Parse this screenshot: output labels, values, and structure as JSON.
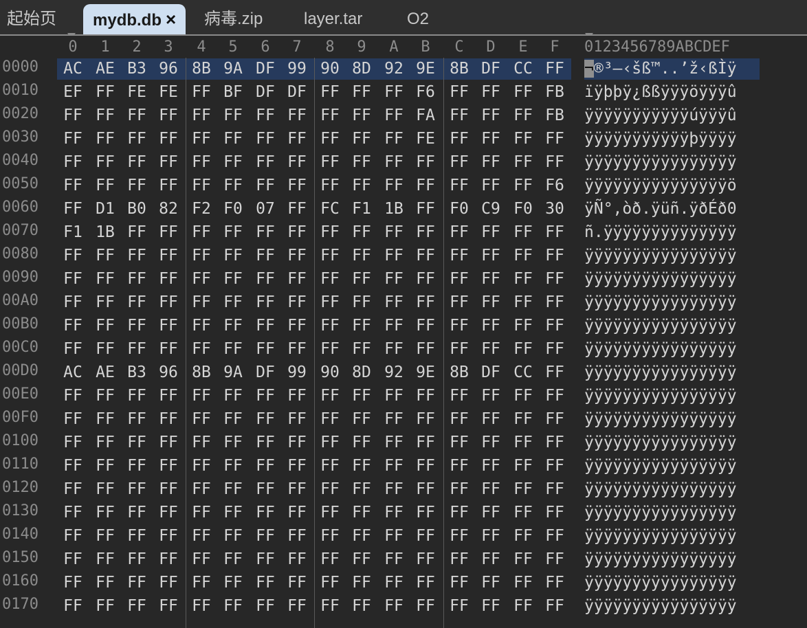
{
  "tabs": [
    {
      "label": "起始页",
      "active": false
    },
    {
      "label": "mydb.db",
      "active": true,
      "close": "×"
    },
    {
      "label": "病毒.zip",
      "active": false
    },
    {
      "label": "layer.tar",
      "active": false
    },
    {
      "label": "O2",
      "active": false
    }
  ],
  "header": {
    "columns": [
      "0",
      "1",
      "2",
      "3",
      "4",
      "5",
      "6",
      "7",
      "8",
      "9",
      "A",
      "B",
      "C",
      "D",
      "E",
      "F"
    ],
    "ascii_header": "0123456789ABCDEF"
  },
  "rows": [
    {
      "addr": "0000",
      "bytes": [
        "AC",
        "AE",
        "B3",
        "96",
        "8B",
        "9A",
        "DF",
        "99",
        "90",
        "8D",
        "92",
        "9E",
        "8B",
        "DF",
        "CC",
        "FF"
      ],
      "ascii": "¬®³–‹šß™..’ž‹ßÌÿ",
      "selected": true
    },
    {
      "addr": "0010",
      "bytes": [
        "EF",
        "FF",
        "FE",
        "FE",
        "FF",
        "BF",
        "DF",
        "DF",
        "FF",
        "FF",
        "FF",
        "F6",
        "FF",
        "FF",
        "FF",
        "FB"
      ],
      "ascii": "ïÿþþÿ¿ßßÿÿÿöÿÿÿû"
    },
    {
      "addr": "0020",
      "bytes": [
        "FF",
        "FF",
        "FF",
        "FF",
        "FF",
        "FF",
        "FF",
        "FF",
        "FF",
        "FF",
        "FF",
        "FA",
        "FF",
        "FF",
        "FF",
        "FB"
      ],
      "ascii": "ÿÿÿÿÿÿÿÿÿÿÿúÿÿÿû"
    },
    {
      "addr": "0030",
      "bytes": [
        "FF",
        "FF",
        "FF",
        "FF",
        "FF",
        "FF",
        "FF",
        "FF",
        "FF",
        "FF",
        "FF",
        "FE",
        "FF",
        "FF",
        "FF",
        "FF"
      ],
      "ascii": "ÿÿÿÿÿÿÿÿÿÿÿþÿÿÿÿ"
    },
    {
      "addr": "0040",
      "bytes": [
        "FF",
        "FF",
        "FF",
        "FF",
        "FF",
        "FF",
        "FF",
        "FF",
        "FF",
        "FF",
        "FF",
        "FF",
        "FF",
        "FF",
        "FF",
        "FF"
      ],
      "ascii": "ÿÿÿÿÿÿÿÿÿÿÿÿÿÿÿÿ"
    },
    {
      "addr": "0050",
      "bytes": [
        "FF",
        "FF",
        "FF",
        "FF",
        "FF",
        "FF",
        "FF",
        "FF",
        "FF",
        "FF",
        "FF",
        "FF",
        "FF",
        "FF",
        "FF",
        "F6"
      ],
      "ascii": "ÿÿÿÿÿÿÿÿÿÿÿÿÿÿÿö"
    },
    {
      "addr": "0060",
      "bytes": [
        "FF",
        "D1",
        "B0",
        "82",
        "F2",
        "F0",
        "07",
        "FF",
        "FC",
        "F1",
        "1B",
        "FF",
        "F0",
        "C9",
        "F0",
        "30"
      ],
      "ascii": "ÿÑ°‚òð.ÿüñ.ÿðÉð0"
    },
    {
      "addr": "0070",
      "bytes": [
        "F1",
        "1B",
        "FF",
        "FF",
        "FF",
        "FF",
        "FF",
        "FF",
        "FF",
        "FF",
        "FF",
        "FF",
        "FF",
        "FF",
        "FF",
        "FF"
      ],
      "ascii": "ñ.ÿÿÿÿÿÿÿÿÿÿÿÿÿÿ"
    },
    {
      "addr": "0080",
      "bytes": [
        "FF",
        "FF",
        "FF",
        "FF",
        "FF",
        "FF",
        "FF",
        "FF",
        "FF",
        "FF",
        "FF",
        "FF",
        "FF",
        "FF",
        "FF",
        "FF"
      ],
      "ascii": "ÿÿÿÿÿÿÿÿÿÿÿÿÿÿÿÿ"
    },
    {
      "addr": "0090",
      "bytes": [
        "FF",
        "FF",
        "FF",
        "FF",
        "FF",
        "FF",
        "FF",
        "FF",
        "FF",
        "FF",
        "FF",
        "FF",
        "FF",
        "FF",
        "FF",
        "FF"
      ],
      "ascii": "ÿÿÿÿÿÿÿÿÿÿÿÿÿÿÿÿ"
    },
    {
      "addr": "00A0",
      "bytes": [
        "FF",
        "FF",
        "FF",
        "FF",
        "FF",
        "FF",
        "FF",
        "FF",
        "FF",
        "FF",
        "FF",
        "FF",
        "FF",
        "FF",
        "FF",
        "FF"
      ],
      "ascii": "ÿÿÿÿÿÿÿÿÿÿÿÿÿÿÿÿ"
    },
    {
      "addr": "00B0",
      "bytes": [
        "FF",
        "FF",
        "FF",
        "FF",
        "FF",
        "FF",
        "FF",
        "FF",
        "FF",
        "FF",
        "FF",
        "FF",
        "FF",
        "FF",
        "FF",
        "FF"
      ],
      "ascii": "ÿÿÿÿÿÿÿÿÿÿÿÿÿÿÿÿ"
    },
    {
      "addr": "00C0",
      "bytes": [
        "FF",
        "FF",
        "FF",
        "FF",
        "FF",
        "FF",
        "FF",
        "FF",
        "FF",
        "FF",
        "FF",
        "FF",
        "FF",
        "FF",
        "FF",
        "FF"
      ],
      "ascii": "ÿÿÿÿÿÿÿÿÿÿÿÿÿÿÿÿ"
    },
    {
      "addr": "00D0",
      "bytes": [
        "AC",
        "AE",
        "B3",
        "96",
        "8B",
        "9A",
        "DF",
        "99",
        "90",
        "8D",
        "92",
        "9E",
        "8B",
        "DF",
        "CC",
        "FF"
      ],
      "ascii": "ÿÿÿÿÿÿÿÿÿÿÿÿÿÿÿÿ"
    },
    {
      "addr": "00E0",
      "bytes": [
        "FF",
        "FF",
        "FF",
        "FF",
        "FF",
        "FF",
        "FF",
        "FF",
        "FF",
        "FF",
        "FF",
        "FF",
        "FF",
        "FF",
        "FF",
        "FF"
      ],
      "ascii": "ÿÿÿÿÿÿÿÿÿÿÿÿÿÿÿÿ"
    },
    {
      "addr": "00F0",
      "bytes": [
        "FF",
        "FF",
        "FF",
        "FF",
        "FF",
        "FF",
        "FF",
        "FF",
        "FF",
        "FF",
        "FF",
        "FF",
        "FF",
        "FF",
        "FF",
        "FF"
      ],
      "ascii": "ÿÿÿÿÿÿÿÿÿÿÿÿÿÿÿÿ"
    },
    {
      "addr": "0100",
      "bytes": [
        "FF",
        "FF",
        "FF",
        "FF",
        "FF",
        "FF",
        "FF",
        "FF",
        "FF",
        "FF",
        "FF",
        "FF",
        "FF",
        "FF",
        "FF",
        "FF"
      ],
      "ascii": "ÿÿÿÿÿÿÿÿÿÿÿÿÿÿÿÿ"
    },
    {
      "addr": "0110",
      "bytes": [
        "FF",
        "FF",
        "FF",
        "FF",
        "FF",
        "FF",
        "FF",
        "FF",
        "FF",
        "FF",
        "FF",
        "FF",
        "FF",
        "FF",
        "FF",
        "FF"
      ],
      "ascii": "ÿÿÿÿÿÿÿÿÿÿÿÿÿÿÿÿ"
    },
    {
      "addr": "0120",
      "bytes": [
        "FF",
        "FF",
        "FF",
        "FF",
        "FF",
        "FF",
        "FF",
        "FF",
        "FF",
        "FF",
        "FF",
        "FF",
        "FF",
        "FF",
        "FF",
        "FF"
      ],
      "ascii": "ÿÿÿÿÿÿÿÿÿÿÿÿÿÿÿÿ"
    },
    {
      "addr": "0130",
      "bytes": [
        "FF",
        "FF",
        "FF",
        "FF",
        "FF",
        "FF",
        "FF",
        "FF",
        "FF",
        "FF",
        "FF",
        "FF",
        "FF",
        "FF",
        "FF",
        "FF"
      ],
      "ascii": "ÿÿÿÿÿÿÿÿÿÿÿÿÿÿÿÿ"
    },
    {
      "addr": "0140",
      "bytes": [
        "FF",
        "FF",
        "FF",
        "FF",
        "FF",
        "FF",
        "FF",
        "FF",
        "FF",
        "FF",
        "FF",
        "FF",
        "FF",
        "FF",
        "FF",
        "FF"
      ],
      "ascii": "ÿÿÿÿÿÿÿÿÿÿÿÿÿÿÿÿ"
    },
    {
      "addr": "0150",
      "bytes": [
        "FF",
        "FF",
        "FF",
        "FF",
        "FF",
        "FF",
        "FF",
        "FF",
        "FF",
        "FF",
        "FF",
        "FF",
        "FF",
        "FF",
        "FF",
        "FF"
      ],
      "ascii": "ÿÿÿÿÿÿÿÿÿÿÿÿÿÿÿÿ"
    },
    {
      "addr": "0160",
      "bytes": [
        "FF",
        "FF",
        "FF",
        "FF",
        "FF",
        "FF",
        "FF",
        "FF",
        "FF",
        "FF",
        "FF",
        "FF",
        "FF",
        "FF",
        "FF",
        "FF"
      ],
      "ascii": "ÿÿÿÿÿÿÿÿÿÿÿÿÿÿÿÿ"
    },
    {
      "addr": "0170",
      "bytes": [
        "FF",
        "FF",
        "FF",
        "FF",
        "FF",
        "FF",
        "FF",
        "FF",
        "FF",
        "FF",
        "FF",
        "FF",
        "FF",
        "FF",
        "FF",
        "FF"
      ],
      "ascii": "ÿÿÿÿÿÿÿÿÿÿÿÿÿÿÿÿ"
    }
  ]
}
